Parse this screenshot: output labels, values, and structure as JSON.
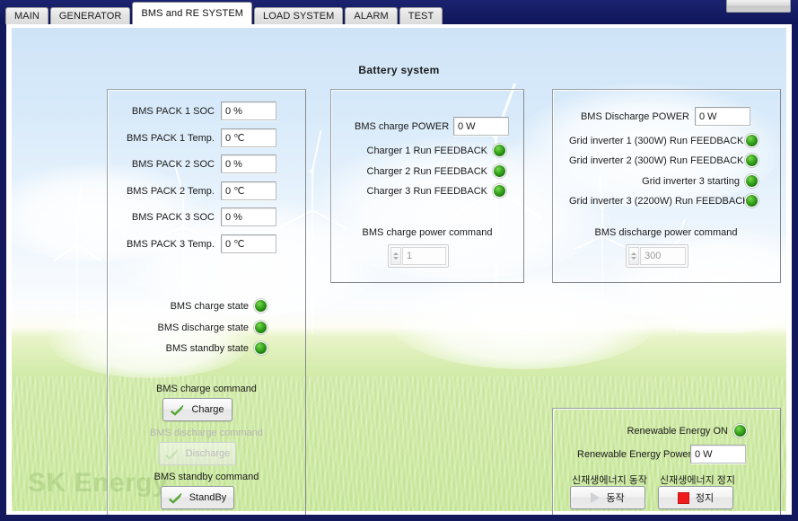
{
  "window": {
    "title_bar_button": "",
    "tabs": [
      {
        "label": "MAIN",
        "active": false
      },
      {
        "label": "GENERATOR",
        "active": false
      },
      {
        "label": "BMS and RE SYSTEM",
        "active": true
      },
      {
        "label": "LOAD SYSTEM",
        "active": false
      },
      {
        "label": "ALARM",
        "active": false
      },
      {
        "label": "TEST",
        "active": false
      }
    ]
  },
  "page": {
    "title": "Battery system",
    "watermark": "SK Energy"
  },
  "bms_pack_panel": {
    "rows": [
      {
        "label": "BMS PACK 1 SOC",
        "value": "0 %"
      },
      {
        "label": "BMS PACK 1 Temp.",
        "value": "0 ℃"
      },
      {
        "label": "BMS PACK 2 SOC",
        "value": "0 %"
      },
      {
        "label": "BMS PACK 2 Temp.",
        "value": "0 ℃"
      },
      {
        "label": "BMS PACK 3 SOC",
        "value": "0 %"
      },
      {
        "label": "BMS PACK 3 Temp.",
        "value": "0 ℃"
      }
    ],
    "states": [
      {
        "label": "BMS charge state",
        "led": "green"
      },
      {
        "label": "BMS discharge state",
        "led": "green"
      },
      {
        "label": "BMS standby state",
        "led": "green"
      }
    ],
    "commands": [
      {
        "caption": "BMS charge command",
        "button": "Charge",
        "icon": "check-icon",
        "enabled": true
      },
      {
        "caption": "BMS discharge command",
        "button": "Discharge",
        "icon": "check-icon",
        "enabled": false
      },
      {
        "caption": "BMS standby command",
        "button": "StandBy",
        "icon": "check-icon",
        "enabled": true
      }
    ]
  },
  "charge_panel": {
    "power_label": "BMS charge POWER",
    "power_value": "0 W",
    "feedback": [
      {
        "label": "Charger 1 Run FEEDBACK",
        "led": "green"
      },
      {
        "label": "Charger 2 Run FEEDBACK",
        "led": "green"
      },
      {
        "label": "Charger 3 Run FEEDBACK",
        "led": "green"
      }
    ],
    "command_caption": "BMS charge power command",
    "command_value": "1"
  },
  "discharge_panel": {
    "power_label": "BMS Discharge POWER",
    "power_value": "0 W",
    "feedback": [
      {
        "label": "Grid inverter 1 (300W) Run FEEDBACK",
        "led": "green"
      },
      {
        "label": "Grid inverter 2 (300W)  Run FEEDBACK",
        "led": "green"
      },
      {
        "label": "Grid inverter 3 starting",
        "led": "green"
      },
      {
        "label": "Grid inverter 3 (2200W) Run FEEDBACK",
        "led": "green"
      }
    ],
    "command_caption": "BMS discharge power command",
    "command_value": "300"
  },
  "renewable_panel": {
    "on_label": "Renewable Energy ON",
    "on_led": "green",
    "power_label": "Renewable Energy Power",
    "power_value": "0 W",
    "run_caption": "신재생에너지  동작",
    "stop_caption": "신재생에너지  정지",
    "run_button": "동작",
    "stop_button": "정지"
  },
  "colors": {
    "frame": "#151c63",
    "led_green": "#3fae23",
    "stop_red": "#ee1c1c",
    "sky": "#d8eafa",
    "grass": "#dcefbb"
  }
}
